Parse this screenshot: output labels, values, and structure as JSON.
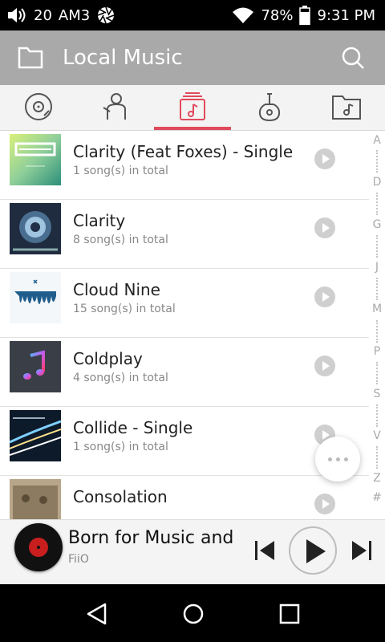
{
  "status_bar": {
    "signal_or_volume_value": "20",
    "carrier": "AM3",
    "battery": "78%",
    "time": "9:31 PM"
  },
  "app_bar": {
    "title": "Local Music"
  },
  "tabs": [
    {
      "icon": "disc-icon",
      "active": false
    },
    {
      "icon": "artist-icon",
      "active": false
    },
    {
      "icon": "album-icon",
      "active": true
    },
    {
      "icon": "guitar-icon",
      "active": false
    },
    {
      "icon": "music-folder-icon",
      "active": false
    }
  ],
  "accent_color": "#e04a5c",
  "albums": [
    {
      "title": "Clarity (Feat Foxes) - Single",
      "subtitle": "1 song(s) in total"
    },
    {
      "title": "Clarity",
      "subtitle": "8 song(s) in total"
    },
    {
      "title": "Cloud Nine",
      "subtitle": "15 song(s) in total"
    },
    {
      "title": "Coldplay",
      "subtitle": "4 song(s) in total"
    },
    {
      "title": "Collide - Single",
      "subtitle": "1 song(s) in total"
    },
    {
      "title": "Consolation",
      "subtitle": ""
    }
  ],
  "alpha_index": [
    "A",
    "D",
    "G",
    "J",
    "M",
    "P",
    "S",
    "V",
    "Z",
    "#"
  ],
  "now_playing": {
    "title": "Born for Music and",
    "artist": "FiiO"
  }
}
